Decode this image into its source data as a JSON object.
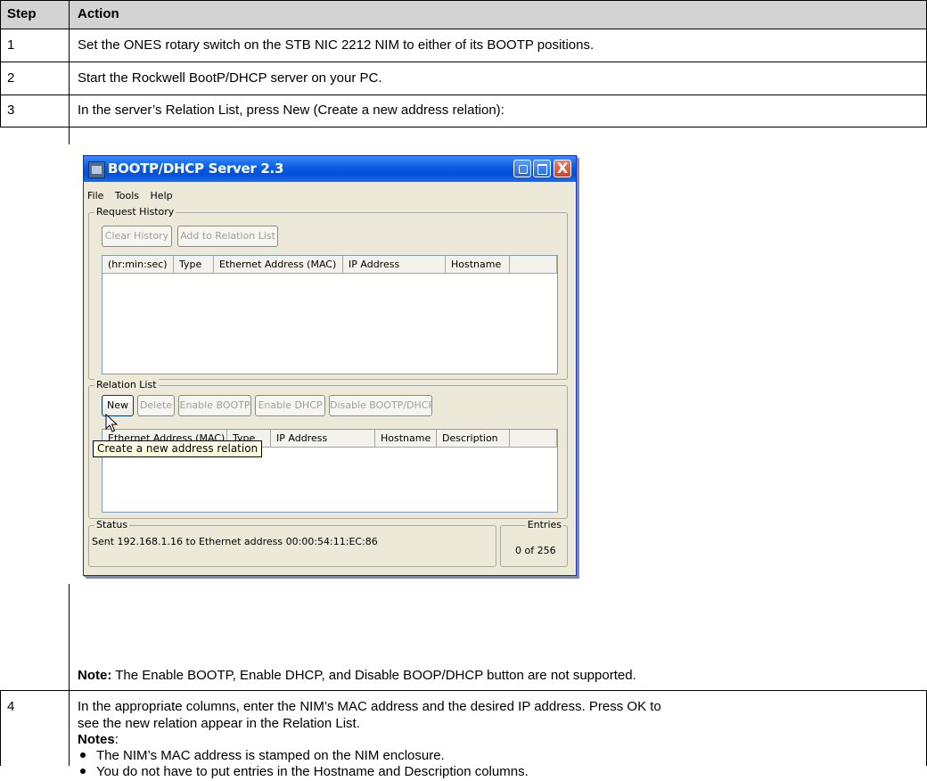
{
  "table": {
    "headers": {
      "step": "Step",
      "action": "Action"
    },
    "rows": [
      {
        "step": "1",
        "action": "Set the ONES rotary switch on the STB NIC 2212 NIM to either of its BOOTP positions."
      },
      {
        "step": "2",
        "action": "Start the Rockwell BootP/DHCP server on your PC."
      },
      {
        "step": "3",
        "action": "In the server’s Relation List, press New (Create a new address relation):"
      },
      {
        "step": "4"
      }
    ],
    "row3_note": {
      "label": "Note:",
      "text": " The Enable BOOTP, Enable DHCP, and Disable BOOP/DHCP button are not supported."
    },
    "row4": {
      "line1": "In the appropriate columns, enter the NIM’s MAC address and the desired IP address. Press OK to",
      "line2": "see the new relation appear in the Relation List.",
      "notes_label": "Notes",
      "notes_colon": ":",
      "bullets": [
        "The NIM’s MAC address is stamped on the NIM enclosure.",
        "You do not have to put entries in the Hostname and Description columns."
      ]
    }
  },
  "window": {
    "title": "BOOTP/DHCP Server 2.3",
    "close_glyph": "X",
    "menu": [
      "File",
      "Tools",
      "Help"
    ],
    "request_history": {
      "label": "Request History",
      "buttons": [
        "Clear History",
        "Add to Relation List"
      ],
      "columns": [
        "(hr:min:sec)",
        "Type",
        "Ethernet Address (MAC)",
        "IP Address",
        "Hostname"
      ]
    },
    "relation_list": {
      "label": "Relation List",
      "buttons": [
        "New",
        "Delete",
        "Enable BOOTP",
        "Enable DHCP",
        "Disable BOOTP/DHCP"
      ],
      "columns": [
        "Ethernet Address (MAC)",
        "Type",
        "IP Address",
        "Hostname",
        "Description"
      ]
    },
    "tooltip": "Create a new address relation",
    "status": {
      "label": "Status",
      "text": "Sent 192.168.1.16 to Ethernet address 00:00:54:11:EC:86"
    },
    "entries": {
      "label": "Entries",
      "value": "0 of 256"
    }
  },
  "colors": {
    "header_bg": "#d3d3d3",
    "xp_title_blue": "#0a5ce5",
    "xp_face": "#ece9d8",
    "tooltip_bg": "#ffffe1"
  },
  "icons": [
    "app-icon",
    "minimize-icon",
    "maximize-icon",
    "close-icon",
    "mouse-cursor-icon",
    "bullet-icon"
  ]
}
